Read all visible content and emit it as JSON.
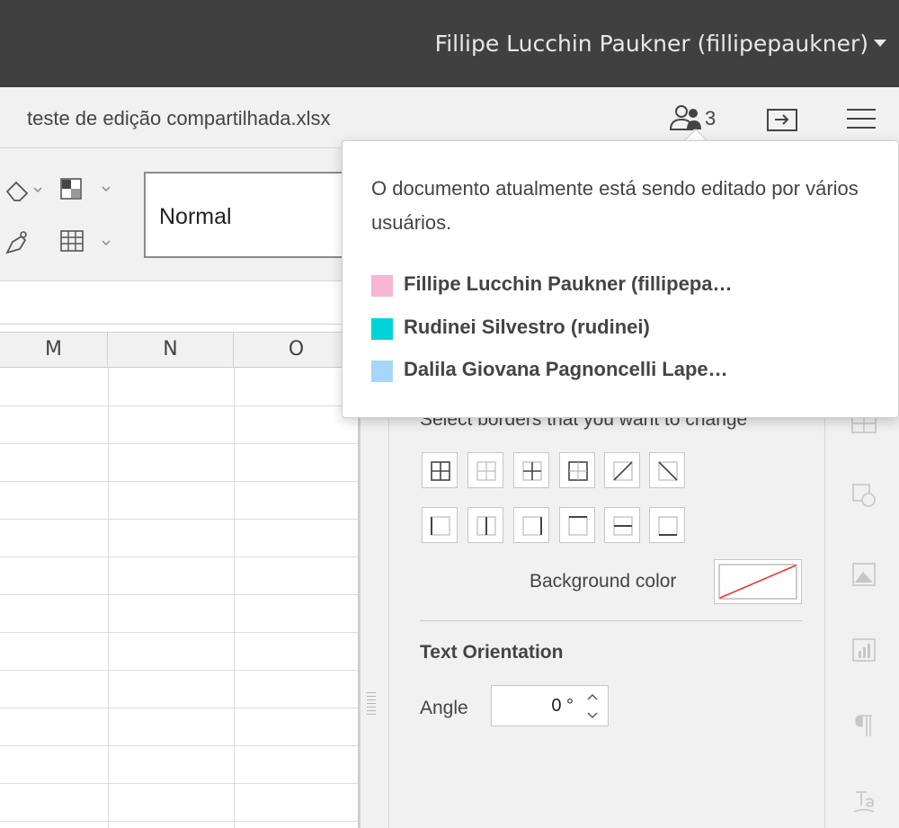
{
  "header": {
    "user_menu_label": "Fillipe Lucchin Paukner (fillipepaukner)"
  },
  "document": {
    "title": "teste de edição compartilhada.xlsx",
    "users_count": "3"
  },
  "toolbar": {
    "cell_style_value": "Normal"
  },
  "grid": {
    "columns": [
      "M",
      "N",
      "O"
    ]
  },
  "popover": {
    "message": "O documento atualmente está sendo editado por vários usuários.",
    "users": [
      {
        "name": "Fillipe Lucchin Paukner (fillipepa…",
        "color": "#f7b6d4"
      },
      {
        "name": "Rudinei Silvestro (rudinei)",
        "color": "#00d4d8"
      },
      {
        "name": "Dalila Giovana Pagnoncelli Lape…",
        "color": "#a6d6f8"
      }
    ]
  },
  "cell_settings": {
    "borders_caption": "Select borders that you want to change",
    "background_color_label": "Background color",
    "text_orientation_title": "Text Orientation",
    "angle_label": "Angle",
    "angle_value": "0 °"
  },
  "colors": {
    "topbar": "#404040",
    "no_fill_line": "#e53935"
  }
}
